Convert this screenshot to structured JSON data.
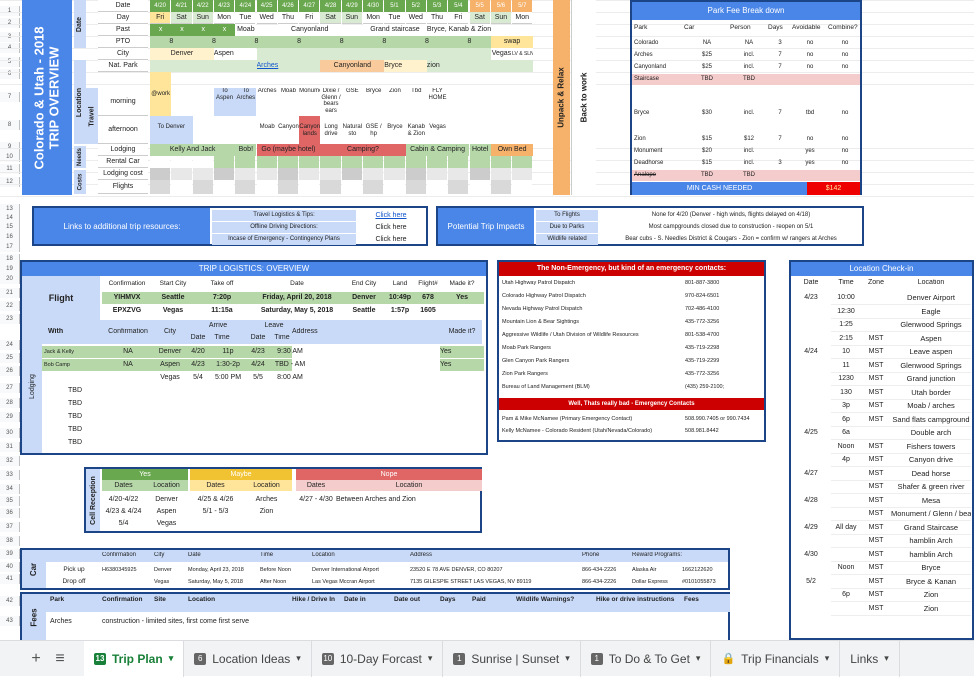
{
  "overview": {
    "title_line1": "Colorado & Utah - 2018",
    "title_line2": "TRIP OVERVIEW",
    "side_date": "Date",
    "side_location": "Location",
    "side_travel": "Travel",
    "side_needs": "Needs",
    "side_costs": "Costs",
    "rows": [
      "Date",
      "Day",
      "Past",
      "PTO",
      "City",
      "Nat. Park",
      "morning",
      "afternoon",
      "Lodging",
      "Rental Car",
      "Lodging cost",
      "Flights"
    ],
    "dates": [
      "4/20",
      "4/21",
      "4/22",
      "4/23",
      "4/24",
      "4/25",
      "4/26",
      "4/27",
      "4/28",
      "4/29",
      "4/30",
      "5/1",
      "5/2",
      "5/3",
      "5/4",
      "5/5",
      "5/6",
      "5/7"
    ],
    "days": [
      "Fri",
      "Sat",
      "Sun",
      "Mon",
      "Tue",
      "Wed",
      "Thu",
      "Fri",
      "Sat",
      "Sun",
      "Mon",
      "Tue",
      "Wed",
      "Thu",
      "Fri",
      "Sat",
      "Sun",
      "Mon"
    ],
    "past": [
      "x",
      "x",
      "x",
      "x",
      "Moab",
      "Canyonland",
      "Grand staircase",
      "Bryce, Kanab & Zion"
    ],
    "pto": [
      "8",
      "8",
      "8",
      "8",
      "8",
      "8",
      "8",
      "8",
      "swap"
    ],
    "city": [
      "Denver",
      "Aspen",
      "Vegas",
      "LV & SLN"
    ],
    "natpark": [
      "Arches",
      "Canyonland",
      "Bryce",
      "zion"
    ],
    "morning": [
      "To Aspen",
      "To Arches",
      "Arches",
      "Moab",
      "Monument",
      "Dixie / Glenn / bears ears",
      "GSE",
      "Bryce",
      "Zion",
      "Tbd",
      "FLY HOME"
    ],
    "afternoon": [
      "To Denver",
      "Moab",
      "Canyon",
      "Canyon lands",
      "Long drive",
      "Natural sto",
      "GSE / hp",
      "Bryce",
      "Kanab & Zion",
      "Vegas"
    ],
    "lodging": [
      "Kelly And Jack",
      "Bob!",
      "Go (maybe hotel)",
      "Camping?",
      "Cabin & Camping",
      "Hotel",
      "Own Bed"
    ],
    "unpack": "Unpack & Relax",
    "backwork": "Back to work",
    "wk": "@work"
  },
  "parkfee": {
    "title": "Park Fee Break down",
    "headers": [
      "Park",
      "Car",
      "Person",
      "Days",
      "Avoidable",
      "Combine?"
    ],
    "rows": [
      [
        "Colorado",
        "NA",
        "NA",
        "3",
        "no",
        "no"
      ],
      [
        "Arches",
        "$25",
        "incl.",
        "7",
        "no",
        "no"
      ],
      [
        "Canyonland",
        "$25",
        "incl.",
        "7",
        "no",
        "no"
      ],
      [
        "Staircase",
        "TBD",
        "TBD",
        "",
        "",
        ""
      ],
      [
        "",
        "",
        "",
        "",
        "",
        ""
      ],
      [
        "Bryce",
        "$30",
        "incl.",
        "7",
        "tbd",
        "no"
      ],
      [
        "",
        "",
        "",
        "",
        "",
        ""
      ],
      [
        "Zion",
        "$15",
        "$12",
        "7",
        "no",
        "no"
      ],
      [
        "Monument",
        "$20",
        "incl.",
        "",
        "yes",
        "no"
      ],
      [
        "Deadhorse",
        "$15",
        "incl.",
        "3",
        "yes",
        "no"
      ],
      [
        "Analope",
        "TBD",
        "TBD",
        "",
        "",
        ""
      ]
    ],
    "min_cash": "MIN CASH NEEDED",
    "min_cash_val": "$142"
  },
  "links": {
    "title": "Links to additional trip resources:",
    "rows": [
      [
        "Travel Logistics & Tips:",
        "Click here"
      ],
      [
        "Offline Driving Directions:",
        "Click here"
      ],
      [
        "Incase of Emergency - Contingency Plans",
        "Click here"
      ]
    ]
  },
  "impacts": {
    "title": "Potential Trip Impacts",
    "rows": [
      [
        "To Flights",
        "None for 4/20 (Denver - high winds, flights delayed on 4/18)"
      ],
      [
        "Due to Parks",
        "Most campgrounds closed due to construction - reopen on 5/1"
      ],
      [
        "Wildlife related",
        "Bear cubs - S. Needles District & Cougars - Zion = confirm w/ rangers at Arches"
      ]
    ]
  },
  "logistics": {
    "title": "TRIP LOGISTICS: OVERVIEW",
    "flight_label": "Flight",
    "flight_headers": [
      "Confirmation",
      "Start City",
      "Take off",
      "Date",
      "End City",
      "Land",
      "Flight#",
      "Made it?"
    ],
    "flights": [
      [
        "YIHMVX",
        "Seattle",
        "7:20p",
        "Friday, April 20, 2018",
        "Denver",
        "10:49p",
        "678",
        "Yes"
      ],
      [
        "EPXZVG",
        "Vegas",
        "11:15a",
        "Saturday, May 5, 2018",
        "Seattle",
        "1:57p",
        "1605",
        ""
      ]
    ],
    "lodging_label": "Lodging",
    "lodging_headers": [
      "With",
      "Confirmation",
      "City",
      "Arrive",
      "Leave",
      "Address",
      "Made it?"
    ],
    "lodging_sub": [
      "Date",
      "Time",
      "Date",
      "Time"
    ],
    "lodging": [
      [
        "Jack & Kelly",
        "NA",
        "Denver",
        "4/20",
        "11p",
        "4/23",
        "9:30 AM",
        "Yes"
      ],
      [
        "Bob Camp",
        "NA",
        "Aspen",
        "4/23",
        "1:30-2p",
        "4/24",
        "TBD - AM",
        "Yes"
      ],
      [
        "",
        "",
        "Vegas",
        "5/4",
        "5:00 PM",
        "5/5",
        "8:00 AM",
        ""
      ],
      [
        "TBD",
        "",
        "",
        "",
        "",
        "",
        "",
        ""
      ],
      [
        "TBD",
        "",
        "",
        "",
        "",
        "",
        "",
        ""
      ],
      [
        "TBD",
        "",
        "",
        "",
        "",
        "",
        "",
        ""
      ],
      [
        "TBD",
        "",
        "",
        "",
        "",
        "",
        "",
        ""
      ],
      [
        "TBD",
        "",
        "",
        "",
        "",
        "",
        "",
        ""
      ]
    ]
  },
  "reception": {
    "label": "Cell Reception",
    "yes": "Yes",
    "maybe": "Maybe",
    "nope": "Nope",
    "dates": "Dates",
    "location": "Location",
    "yes_rows": [
      [
        "4/20-4/22",
        "Denver"
      ],
      [
        "4/23 & 4/24",
        "Aspen"
      ],
      [
        "5/4",
        "Vegas"
      ]
    ],
    "maybe_rows": [
      [
        "4/25 & 4/26",
        "Arches"
      ],
      [
        "5/1 - 5/3",
        "Zion"
      ]
    ],
    "nope_rows": [
      [
        "4/27 - 4/30",
        "Between Arches and Zion"
      ]
    ]
  },
  "emergency": {
    "title": "The Non-Emergency, but kind of an emergency contacts:",
    "rows": [
      [
        "Utah Highway Patrol Dispatch",
        "801-887-3800"
      ],
      [
        "Colorado Highway Patrol Dispatch",
        "970-824-6501"
      ],
      [
        "Nevada Highway Patrol Dispatch",
        "702-486-4100"
      ],
      [
        "Mountain Lion & Bear Sightings",
        "435-772-3256"
      ],
      [
        "Aggressive Wildlife / Utah Division of Wildlife Resources",
        "801-538-4700"
      ],
      [
        "Moab Park Rangers",
        "435-719-2298"
      ],
      [
        "Glen Canyon Park Rangers",
        "435-719-2299"
      ],
      [
        "Zion Park Rangers",
        "435-772-3256"
      ],
      [
        "Bureau of Land Management (BLM)",
        "(435) 259-2100;"
      ]
    ],
    "bad_title": "Well, Thats really bad - Emergency Contacts",
    "bad_rows": [
      [
        "Pam & Mike McNamee  (Primary Emergency Contact)",
        "508.990.7405 or 990.7434"
      ],
      [
        "Kelly McNamee -  Colorado Resident (Utah/Nevada/Colorado)",
        "508.981.8442"
      ]
    ]
  },
  "checkin": {
    "title": "Location Check-in",
    "headers": [
      "Date",
      "Time",
      "Zone",
      "Location"
    ],
    "rows": [
      [
        "4/23",
        "10:00",
        "",
        "Denver Airport"
      ],
      [
        "",
        "12:30",
        "",
        "Eagle"
      ],
      [
        "",
        "1:25",
        "",
        "Glenwood Springs"
      ],
      [
        "",
        "2:15",
        "MST",
        "Aspen"
      ],
      [
        "4/24",
        "10",
        "MST",
        "Leave aspen"
      ],
      [
        "",
        "11",
        "MST",
        "Glenwood Springs"
      ],
      [
        "",
        "1230",
        "MST",
        "Grand junction"
      ],
      [
        "",
        "130",
        "MST",
        "Utah border"
      ],
      [
        "",
        "3p",
        "MST",
        "Moab / arches"
      ],
      [
        "",
        "6p",
        "MST",
        "Sand flats campground"
      ],
      [
        "4/25",
        "6a",
        "",
        "Double arch"
      ],
      [
        "",
        "Noon",
        "MST",
        "Fishers towers"
      ],
      [
        "",
        "4p",
        "MST",
        "Canyon drive"
      ],
      [
        "4/27",
        "",
        "MST",
        "Dead horse"
      ],
      [
        "",
        "",
        "MST",
        "Shafer & green river"
      ],
      [
        "4/28",
        "",
        "MST",
        "Mesa"
      ],
      [
        "",
        "",
        "MST",
        "Monument / Glenn / bears"
      ],
      [
        "4/29",
        "All day",
        "MST",
        "Grand Staircase"
      ],
      [
        "",
        "",
        "MST",
        "hamblin Arch"
      ],
      [
        "4/30",
        "",
        "MST",
        "hamblin Arch"
      ],
      [
        "",
        "Noon",
        "MST",
        "Bryce"
      ],
      [
        "5/2",
        "",
        "MST",
        "Bryce & Kanan"
      ],
      [
        "",
        "6p",
        "MST",
        "Zion"
      ],
      [
        "",
        "",
        "MST",
        "Zion"
      ]
    ]
  },
  "car": {
    "label": "Car",
    "headers": [
      "Confirmation",
      "City",
      "Date",
      "Time",
      "Location",
      "Address",
      "Phone",
      "Reward Programs:"
    ],
    "pick_label": "Pick up",
    "drop_label": "Drop off",
    "pick": [
      "H6380345925",
      "Denver",
      "Monday, April 23, 2018",
      "Before Noon",
      "Denver International Airport",
      "23520 E 78 AVE DENVER, CO 80207",
      "866-434-2226",
      "Alaska Air",
      "1662122620"
    ],
    "drop": [
      "",
      "Vegas",
      "Saturday, May 5, 2018",
      "After Noon",
      "Las Vegas Mccran Airport",
      "7135 GILESPIE STREET LAS VEGAS, NV 89119",
      "866-434-2226",
      "Dollar Express",
      "#0101055873"
    ]
  },
  "fees": {
    "label": "Fees",
    "headers": [
      "Park",
      "Confirmation",
      "Site",
      "Location",
      "Hike / Drive In",
      "Date in",
      "Date out",
      "Days",
      "Paid",
      "Wildlife Warnings?",
      "Hike or drive instructions",
      "Fees"
    ],
    "row": [
      "Arches",
      "construction - limited sites, first come first serve"
    ]
  },
  "rownums": [
    "1",
    "2",
    "3",
    "4",
    "5",
    "6",
    "7",
    "8",
    "9",
    "10",
    "11",
    "12",
    "13",
    "14",
    "15",
    "16",
    "17",
    "18",
    "19",
    "20",
    "21",
    "22",
    "23",
    "24",
    "25",
    "26",
    "27",
    "28",
    "29",
    "30",
    "31",
    "32",
    "33",
    "34",
    "35",
    "36",
    "37",
    "38",
    "39",
    "40",
    "41",
    "42",
    "43"
  ],
  "tabs": [
    {
      "num": "13",
      "label": "Trip Plan",
      "active": true
    },
    {
      "num": "6",
      "label": "Location Ideas"
    },
    {
      "num": "10",
      "label": "10-Day Forcast"
    },
    {
      "num": "1",
      "label": "Sunrise | Sunset"
    },
    {
      "num": "1",
      "label": "To Do & To Get"
    },
    {
      "num": "",
      "label": "Trip Financials",
      "lock": true
    },
    {
      "num": "",
      "label": "Links"
    }
  ],
  "colors": {
    "blue": "#4a86e8",
    "green": "#6aa84f",
    "lightgreen": "#b6d7a8",
    "red": "#cc0000",
    "orange": "#e69138",
    "yellow": "#ffe599",
    "tabgreen": "#188038"
  }
}
